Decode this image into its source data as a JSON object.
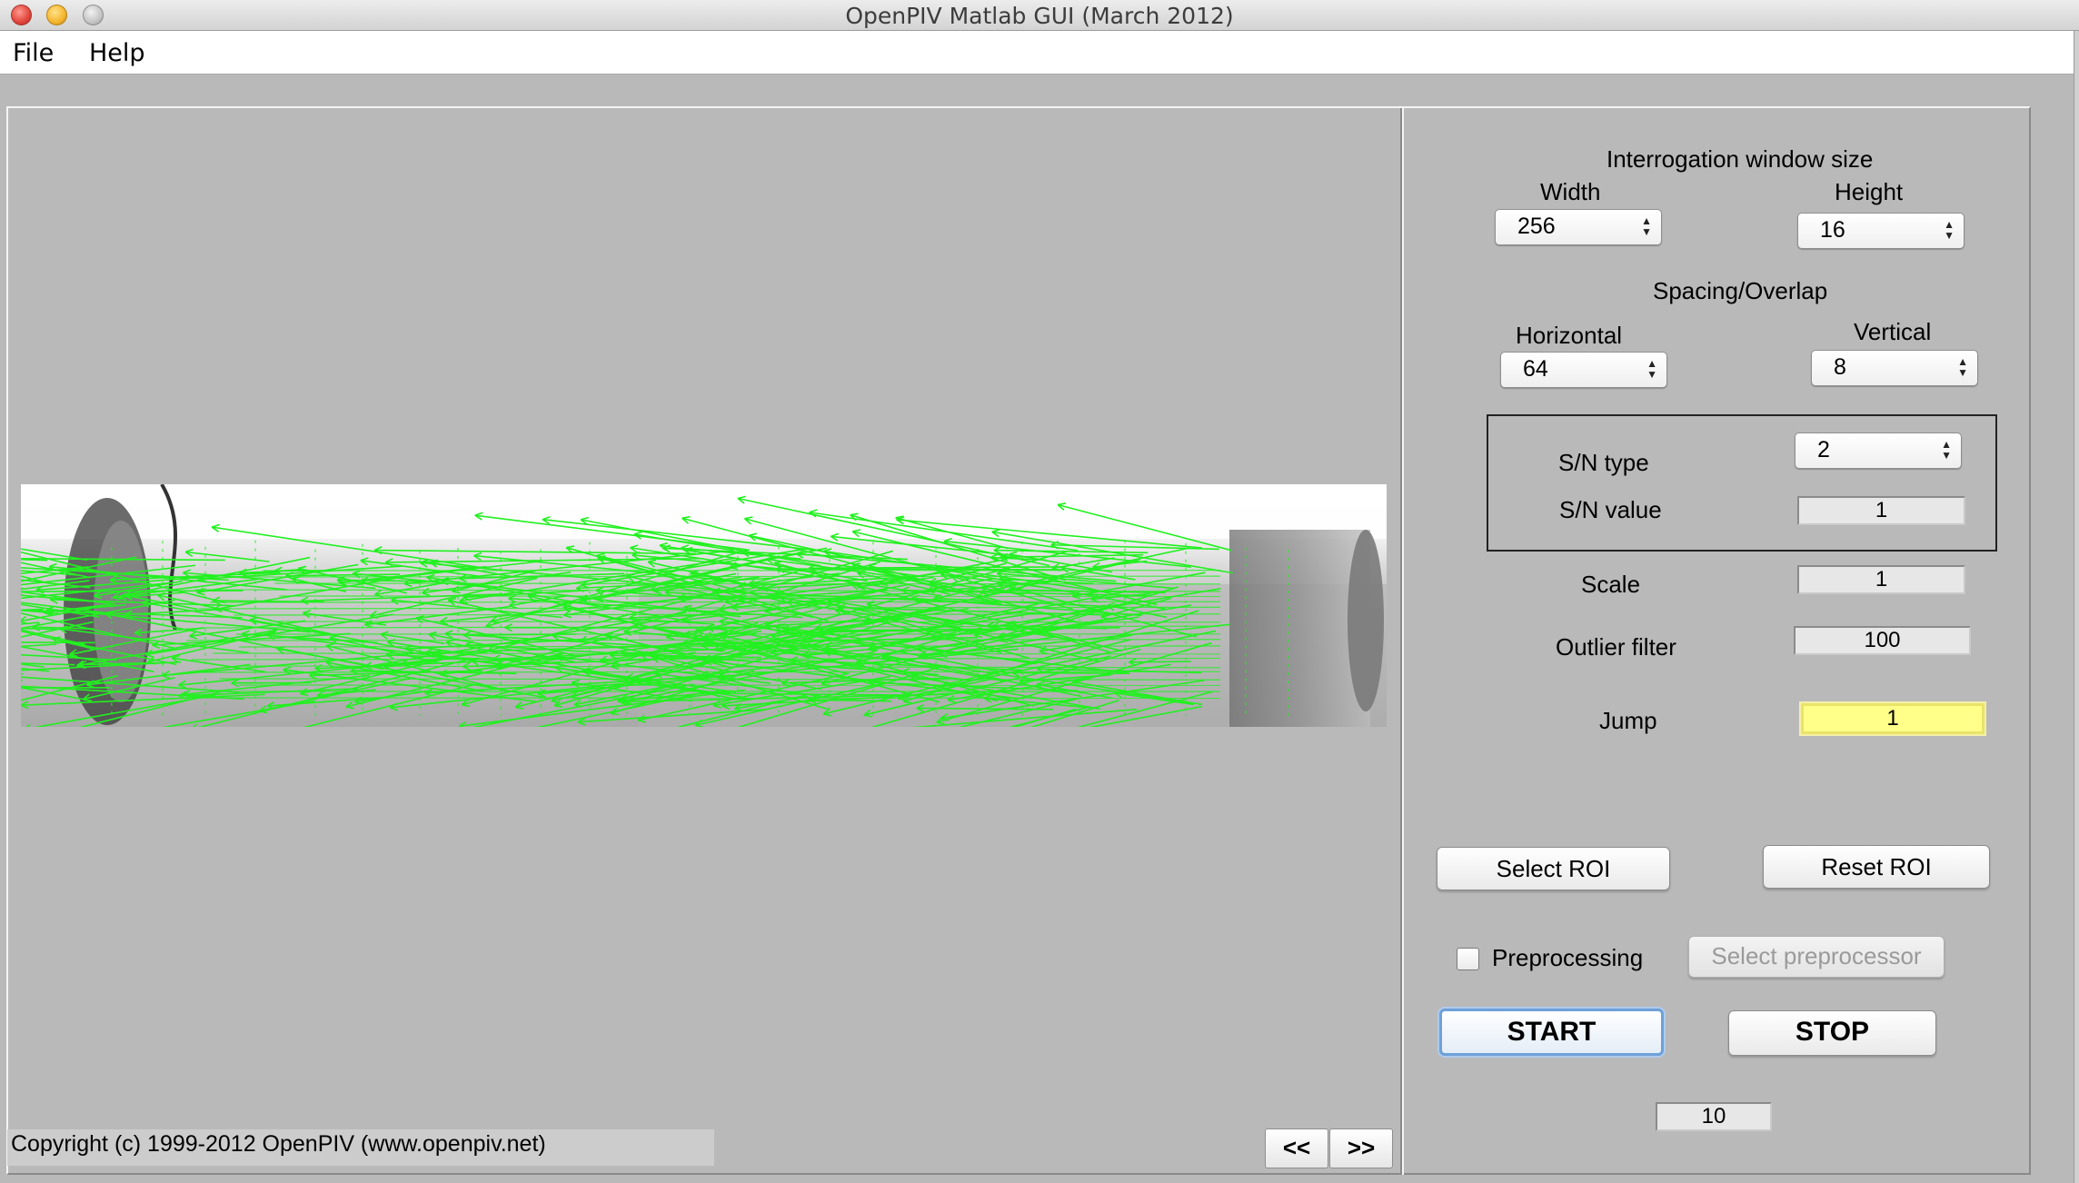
{
  "window": {
    "title": "OpenPIV Matlab GUI (March 2012)"
  },
  "menu": {
    "items": [
      "File",
      "Help"
    ]
  },
  "interrogation": {
    "heading": "Interrogation window size",
    "width_label": "Width",
    "width_value": "256",
    "height_label": "Height",
    "height_value": "16"
  },
  "spacing": {
    "heading": "Spacing/Overlap",
    "horizontal_label": "Horizontal",
    "horizontal_value": "64",
    "vertical_label": "Vertical",
    "vertical_value": "8"
  },
  "sn": {
    "type_label": "S/N type",
    "type_value": "2",
    "value_label": "S/N value",
    "value_value": "1"
  },
  "scale": {
    "label": "Scale",
    "value": "1"
  },
  "outlier": {
    "label": "Outlier filter",
    "value": "100"
  },
  "jump": {
    "label": "Jump",
    "value": "1"
  },
  "roi": {
    "select_label": "Select ROI",
    "reset_label": "Reset ROI"
  },
  "preprocessing": {
    "checkbox_label": "Preprocessing",
    "checked": false,
    "select_label": "Select preprocessor"
  },
  "run": {
    "start_label": "START",
    "stop_label": "STOP"
  },
  "counter": {
    "value": "10"
  },
  "nav": {
    "prev_label": "<<",
    "next_label": ">>"
  },
  "copyright": "Copyright (c) 1999-2012 OpenPIV (www.openpiv.net)",
  "colors": {
    "vector": "#22f020",
    "jump_field": "#ffff8a",
    "panel": "#b9b9b9"
  }
}
